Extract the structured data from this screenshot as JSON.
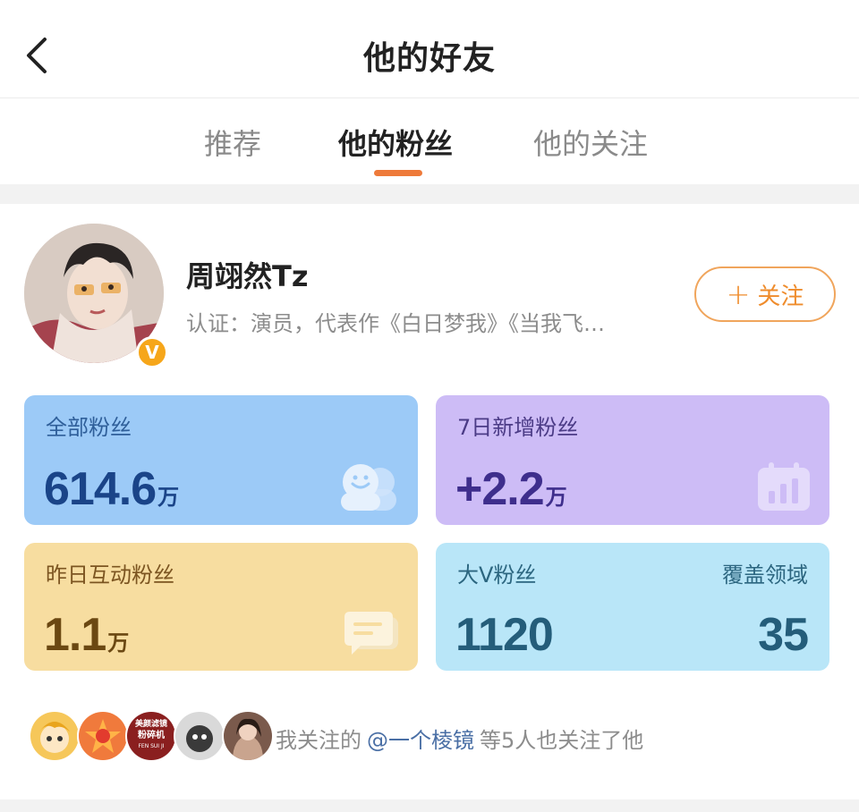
{
  "header": {
    "title": "他的好友"
  },
  "tabs": [
    {
      "label": "推荐",
      "active": false
    },
    {
      "label": "他的粉丝",
      "active": true
    },
    {
      "label": "他的关注",
      "active": false
    }
  ],
  "profile": {
    "name": "周翊然Tz",
    "description": "认证：演员，代表作《白日梦我》《当我飞…",
    "badge_letter": "V",
    "follow_label": "关注",
    "follow_plus": "+"
  },
  "stats": {
    "all_fans": {
      "label": "全部粉丝",
      "value": "614.6",
      "unit": "万"
    },
    "new_7d": {
      "label": "7日新增粉丝",
      "value": "+2.2",
      "unit": "万"
    },
    "interactive_yesterday": {
      "label": "昨日互动粉丝",
      "value": "1.1",
      "unit": "万"
    },
    "big_v": {
      "label": "大V粉丝",
      "value": "1120",
      "coverage_label": "覆盖领域",
      "coverage_value": "35"
    }
  },
  "mutual": {
    "prefix": "我关注的",
    "link": "@一个棱镜",
    "suffix": "等5人也关注了他",
    "avatar3_text_top": "美颜滤镜",
    "avatar3_text_mid": "粉碎机",
    "avatar3_text_bottom": "FEN SUI JI"
  },
  "colors": {
    "accent": "#ee7a3a",
    "follow_border": "#f0a55c",
    "card_all_fans": "#9ccaf7",
    "card_new_7d": "#cdbcf6",
    "card_interactive": "#f7dda0",
    "card_big_v": "#b9e6f8",
    "link": "#4a6fa5"
  },
  "icons": {
    "back": "chevron-left-icon",
    "fans": "people-icon",
    "chart": "bar-chart-icon",
    "message": "chat-bubble-icon",
    "verified": "verified-v-icon"
  }
}
